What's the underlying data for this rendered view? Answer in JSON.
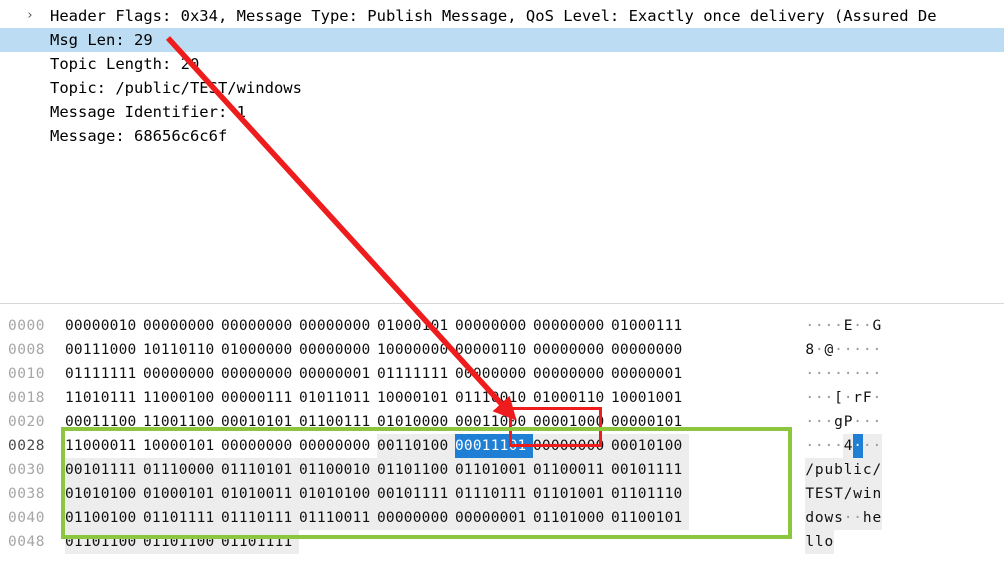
{
  "app": {
    "name": "wireshark-packet-bytes-view",
    "colors": {
      "selection_blue": "#1f7fd4",
      "detail_selection": "#bcdcf4",
      "annotation_red": "#ee1c1c",
      "annotation_green": "#8cc63f",
      "offset_gray": "#a6a6a6",
      "byte_shade": "#ededed"
    }
  },
  "detail_pane": {
    "rows": [
      {
        "id": "row-clipped",
        "text": "",
        "twisty": "",
        "selected": false,
        "clipped": true
      },
      {
        "id": "row-header-flags",
        "twisty": "›",
        "text": "Header Flags: 0x34, Message Type: Publish Message, QoS Level: Exactly once delivery (Assured De",
        "selected": false,
        "clipped": false
      },
      {
        "id": "row-msg-len",
        "twisty": "",
        "text": "Msg Len: 29",
        "selected": true,
        "clipped": false
      },
      {
        "id": "row-topic-length",
        "twisty": "",
        "text": "Topic Length: 20",
        "selected": false,
        "clipped": false
      },
      {
        "id": "row-topic",
        "twisty": "",
        "text": "Topic: /public/TEST/windows",
        "selected": false,
        "clipped": false
      },
      {
        "id": "row-message-identifier",
        "twisty": "",
        "text": "Message Identifier: 1",
        "selected": false,
        "clipped": false
      },
      {
        "id": "row-message",
        "twisty": "",
        "text": "Message: 68656c6c6f",
        "selected": false,
        "clipped": false
      }
    ]
  },
  "bytes_pane": {
    "display_mode": "binary",
    "rows": [
      {
        "offset": "0000",
        "bytes": [
          "00000010",
          "00000000",
          "00000000",
          "00000000",
          "01000101",
          "00000000",
          "00000000",
          "01000111"
        ],
        "ascii": [
          "·",
          "·",
          "·",
          "·",
          "E",
          "·",
          "·",
          "G"
        ],
        "shade_from": null,
        "sel_index": null,
        "row_selected": false
      },
      {
        "offset": "0008",
        "bytes": [
          "00111000",
          "10110110",
          "01000000",
          "00000000",
          "10000000",
          "00000110",
          "00000000",
          "00000000"
        ],
        "ascii": [
          "8",
          "·",
          "@",
          "·",
          "·",
          "·",
          "·",
          "·"
        ],
        "shade_from": null,
        "sel_index": null,
        "row_selected": false
      },
      {
        "offset": "0010",
        "bytes": [
          "01111111",
          "00000000",
          "00000000",
          "00000001",
          "01111111",
          "00000000",
          "00000000",
          "00000001"
        ],
        "ascii": [
          "·",
          "·",
          "·",
          "·",
          "·",
          "·",
          "·",
          "·"
        ],
        "shade_from": null,
        "sel_index": null,
        "row_selected": false
      },
      {
        "offset": "0018",
        "bytes": [
          "11010111",
          "11000100",
          "00000111",
          "01011011",
          "10000101",
          "01110010",
          "01000110",
          "10001001"
        ],
        "ascii": [
          "·",
          "·",
          "·",
          "[",
          "·",
          "r",
          "F",
          "·"
        ],
        "shade_from": null,
        "sel_index": null,
        "row_selected": false
      },
      {
        "offset": "0020",
        "bytes": [
          "00011100",
          "11001100",
          "00010101",
          "01100111",
          "01010000",
          "00011000",
          "00001000",
          "00000101"
        ],
        "ascii": [
          "·",
          "·",
          "·",
          "g",
          "P",
          "·",
          "·",
          "·"
        ],
        "shade_from": null,
        "sel_index": null,
        "row_selected": false
      },
      {
        "offset": "0028",
        "bytes": [
          "11000011",
          "10000101",
          "00000000",
          "00000000",
          "00110100",
          "00011101",
          "00000000",
          "00010100"
        ],
        "ascii": [
          "·",
          "·",
          "·",
          "·",
          "4",
          "·",
          "·",
          "·"
        ],
        "shade_from": 4,
        "sel_index": 5,
        "row_selected": true
      },
      {
        "offset": "0030",
        "bytes": [
          "00101111",
          "01110000",
          "01110101",
          "01100010",
          "01101100",
          "01101001",
          "01100011",
          "00101111"
        ],
        "ascii": [
          "/",
          "p",
          "u",
          "b",
          "l",
          "i",
          "c",
          "/"
        ],
        "shade_from": 0,
        "sel_index": null,
        "row_selected": false
      },
      {
        "offset": "0038",
        "bytes": [
          "01010100",
          "01000101",
          "01010011",
          "01010100",
          "00101111",
          "01110111",
          "01101001",
          "01101110"
        ],
        "ascii": [
          "T",
          "E",
          "S",
          "T",
          "/",
          "w",
          "i",
          "n"
        ],
        "shade_from": 0,
        "sel_index": null,
        "row_selected": false
      },
      {
        "offset": "0040",
        "bytes": [
          "01100100",
          "01101111",
          "01110111",
          "01110011",
          "00000000",
          "00000001",
          "01101000",
          "01100101"
        ],
        "ascii": [
          "d",
          "o",
          "w",
          "s",
          "·",
          "·",
          "h",
          "e"
        ],
        "shade_from": 0,
        "sel_index": null,
        "row_selected": false
      },
      {
        "offset": "0048",
        "bytes": [
          "01101100",
          "01101100",
          "01101111"
        ],
        "ascii": [
          "l",
          "l",
          "o"
        ],
        "shade_from": 0,
        "sel_index": null,
        "row_selected": false
      }
    ]
  },
  "annotations": {
    "red_box": {
      "label": "msg-len-byte-callout",
      "note": "red rectangle around the selected Msg Len byte 00011101"
    },
    "green_box": {
      "label": "payload-region-callout",
      "note": "green rectangle around the topic and message payload bytes"
    },
    "arrow": {
      "label": "msg-len-to-byte-arrow",
      "note": "red arrow from 'Msg Len: 29' down to the highlighted byte"
    }
  }
}
